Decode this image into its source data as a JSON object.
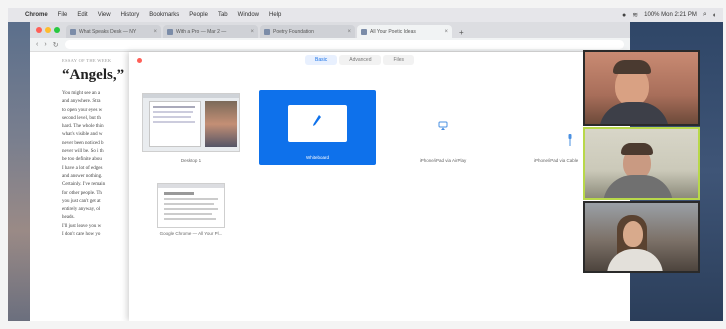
{
  "menubar": {
    "items": [
      "Chrome",
      "File",
      "Edit",
      "View",
      "History",
      "Bookmarks",
      "People",
      "Tab",
      "Window",
      "Help"
    ],
    "status": "100% Mon 2:21 PM"
  },
  "browser": {
    "tabs": [
      {
        "label": "What Speaks Desk — NY"
      },
      {
        "label": "With a Pro — Mar 2 —"
      },
      {
        "label": "Poetry Foundation"
      },
      {
        "label": "All Your Poetic Ideas"
      }
    ]
  },
  "article": {
    "kicker": "ESSAY OF THE WEEK",
    "title": "“Angels,”",
    "lines": [
      "You might see an a",
      "and anywhere. Stra",
      "to open your eyes w",
      "second level, but th",
      "hard. The whole thin",
      "what's visible and w",
      "never been noticed b",
      "never will be. So i th",
      "be too definite abou",
      "I have a lot of edges",
      "and answer nothing.",
      "Certainly. I've remain",
      "for other people. Th",
      "you just can't get at",
      "entirely anyway, ol",
      "heads.",
      "",
      "I'll just leave you w",
      "I don't care how yo"
    ]
  },
  "share_dialog": {
    "tabs": [
      "Basic",
      "Advanced",
      "Files"
    ],
    "active_tab": "Basic",
    "options": [
      {
        "label": "Desktop 1"
      },
      {
        "label": "Whiteboard"
      },
      {
        "label": "iPhone/iPad via AirPlay"
      },
      {
        "label": "iPhone/iPad via Cable"
      },
      {
        "label": "Google Chrome — All Your Pl..."
      }
    ]
  },
  "participants": [
    "participant-1",
    "participant-2",
    "participant-3"
  ],
  "colors": {
    "accent": "#1a73e8",
    "selected_card": "#0e71eb",
    "active_speaker": "#b8d84a"
  }
}
